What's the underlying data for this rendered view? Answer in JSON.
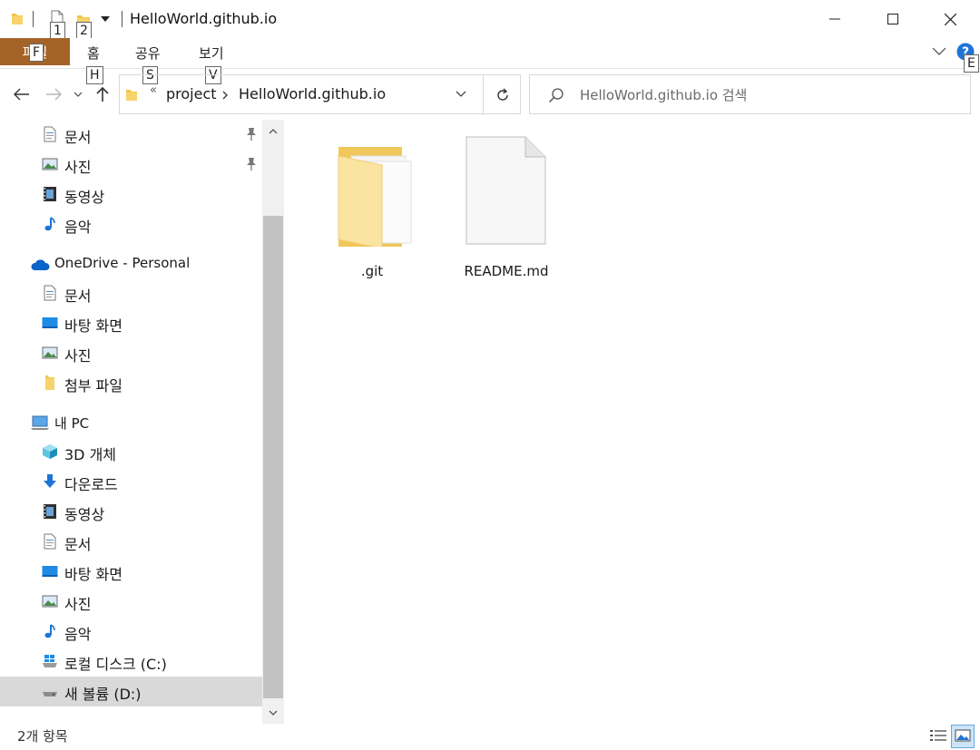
{
  "window": {
    "title": "HelloWorld.github.io"
  },
  "quick_access_keytips": [
    "1",
    "2"
  ],
  "ribbon": {
    "file_tab": "파일",
    "file_keytip": "F",
    "tabs": [
      {
        "label": "홈",
        "keytip": "H"
      },
      {
        "label": "공유",
        "keytip": "S"
      },
      {
        "label": "보기",
        "keytip": "V"
      }
    ],
    "help_keytip": "E"
  },
  "address": {
    "overflow": "«",
    "crumbs": [
      "project",
      "HelloWorld.github.io"
    ]
  },
  "search": {
    "placeholder": "HelloWorld.github.io 검색"
  },
  "sidebar": {
    "quick_access": [
      {
        "label": "문서",
        "icon": "document-icon",
        "pinned": true
      },
      {
        "label": "사진",
        "icon": "pictures-icon",
        "pinned": true
      },
      {
        "label": "동영상",
        "icon": "videos-icon",
        "pinned": false
      },
      {
        "label": "음악",
        "icon": "music-icon",
        "pinned": false
      }
    ],
    "onedrive": {
      "label": "OneDrive - Personal",
      "icon": "cloud-icon",
      "items": [
        {
          "label": "문서",
          "icon": "document-icon"
        },
        {
          "label": "바탕 화면",
          "icon": "desktop-icon"
        },
        {
          "label": "사진",
          "icon": "pictures-icon"
        },
        {
          "label": "첨부 파일",
          "icon": "folder-icon"
        }
      ]
    },
    "this_pc": {
      "label": "내 PC",
      "icon": "computer-icon",
      "items": [
        {
          "label": "3D 개체",
          "icon": "cube-icon"
        },
        {
          "label": "다운로드",
          "icon": "download-icon"
        },
        {
          "label": "동영상",
          "icon": "videos-icon"
        },
        {
          "label": "문서",
          "icon": "document-icon"
        },
        {
          "label": "바탕 화면",
          "icon": "desktop-icon"
        },
        {
          "label": "사진",
          "icon": "pictures-icon"
        },
        {
          "label": "음악",
          "icon": "music-icon"
        },
        {
          "label": "로컬 디스크 (C:)",
          "icon": "windows-drive-icon"
        },
        {
          "label": "새 볼륨 (D:)",
          "icon": "drive-icon",
          "selected": true
        }
      ]
    }
  },
  "files": [
    {
      "name": ".git",
      "icon": "folder-icon"
    },
    {
      "name": "README.md",
      "icon": "file-icon"
    }
  ],
  "status": {
    "item_count": "2개 항목"
  },
  "colors": {
    "file_tab": "#a46428",
    "selection": "#d9d9d9",
    "folder": "#f5d77a",
    "help": "#1e74d6"
  }
}
